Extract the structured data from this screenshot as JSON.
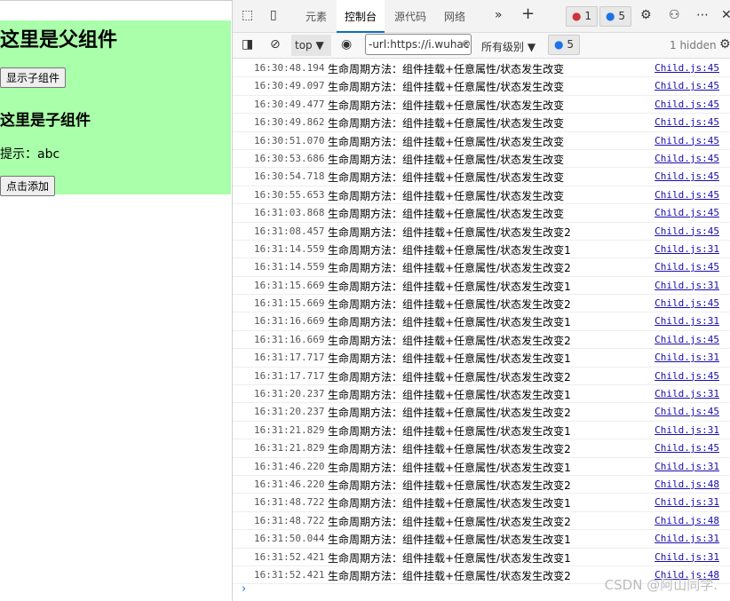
{
  "page": {
    "parent_title": "这里是父组件",
    "show_child_button": "显示子组件",
    "child_title": "这里是子组件",
    "hint": "提示：abc",
    "add_button": "点击添加",
    "parent_bg": "#aaffaa"
  },
  "devtools": {
    "tabs": [
      "元素",
      "控制台",
      "源代码",
      "网络"
    ],
    "active_tab": "控制台",
    "error_count": "1",
    "message_count": "5",
    "context": "top",
    "filter_value": "-url:https://i.wuhac",
    "levels": "所有级别",
    "filter_message_count": "5",
    "hidden": "1 hidden",
    "rows": [
      {
        "ts": "16:30:48.194",
        "msg": "生命周期方法：组件挂载+任意属性/状态发生改变",
        "src": "Child.js:45"
      },
      {
        "ts": "16:30:49.097",
        "msg": "生命周期方法：组件挂载+任意属性/状态发生改变",
        "src": "Child.js:45"
      },
      {
        "ts": "16:30:49.477",
        "msg": "生命周期方法：组件挂载+任意属性/状态发生改变",
        "src": "Child.js:45"
      },
      {
        "ts": "16:30:49.862",
        "msg": "生命周期方法：组件挂载+任意属性/状态发生改变",
        "src": "Child.js:45"
      },
      {
        "ts": "16:30:51.070",
        "msg": "生命周期方法：组件挂载+任意属性/状态发生改变",
        "src": "Child.js:45"
      },
      {
        "ts": "16:30:53.686",
        "msg": "生命周期方法：组件挂载+任意属性/状态发生改变",
        "src": "Child.js:45"
      },
      {
        "ts": "16:30:54.718",
        "msg": "生命周期方法：组件挂载+任意属性/状态发生改变",
        "src": "Child.js:45"
      },
      {
        "ts": "16:30:55.653",
        "msg": "生命周期方法：组件挂载+任意属性/状态发生改变",
        "src": "Child.js:45"
      },
      {
        "ts": "16:31:03.868",
        "msg": "生命周期方法：组件挂载+任意属性/状态发生改变",
        "src": "Child.js:45"
      },
      {
        "ts": "16:31:08.457",
        "msg": "生命周期方法：组件挂载+任意属性/状态发生改变2",
        "src": "Child.js:45"
      },
      {
        "ts": "16:31:14.559",
        "msg": "生命周期方法：组件挂载+任意属性/状态发生改变1",
        "src": "Child.js:31"
      },
      {
        "ts": "16:31:14.559",
        "msg": "生命周期方法：组件挂载+任意属性/状态发生改变2",
        "src": "Child.js:45"
      },
      {
        "ts": "16:31:15.669",
        "msg": "生命周期方法：组件挂载+任意属性/状态发生改变1",
        "src": "Child.js:31"
      },
      {
        "ts": "16:31:15.669",
        "msg": "生命周期方法：组件挂载+任意属性/状态发生改变2",
        "src": "Child.js:45"
      },
      {
        "ts": "16:31:16.669",
        "msg": "生命周期方法：组件挂载+任意属性/状态发生改变1",
        "src": "Child.js:31"
      },
      {
        "ts": "16:31:16.669",
        "msg": "生命周期方法：组件挂载+任意属性/状态发生改变2",
        "src": "Child.js:45"
      },
      {
        "ts": "16:31:17.717",
        "msg": "生命周期方法：组件挂载+任意属性/状态发生改变1",
        "src": "Child.js:31"
      },
      {
        "ts": "16:31:17.717",
        "msg": "生命周期方法：组件挂载+任意属性/状态发生改变2",
        "src": "Child.js:45"
      },
      {
        "ts": "16:31:20.237",
        "msg": "生命周期方法：组件挂载+任意属性/状态发生改变1",
        "src": "Child.js:31"
      },
      {
        "ts": "16:31:20.237",
        "msg": "生命周期方法：组件挂载+任意属性/状态发生改变2",
        "src": "Child.js:45"
      },
      {
        "ts": "16:31:21.829",
        "msg": "生命周期方法：组件挂载+任意属性/状态发生改变1",
        "src": "Child.js:31"
      },
      {
        "ts": "16:31:21.829",
        "msg": "生命周期方法：组件挂载+任意属性/状态发生改变2",
        "src": "Child.js:45"
      },
      {
        "ts": "16:31:46.220",
        "msg": "生命周期方法：组件挂载+任意属性/状态发生改变1",
        "src": "Child.js:31"
      },
      {
        "ts": "16:31:46.220",
        "msg": "生命周期方法：组件挂载+任意属性/状态发生改变2",
        "src": "Child.js:48"
      },
      {
        "ts": "16:31:48.722",
        "msg": "生命周期方法：组件挂载+任意属性/状态发生改变1",
        "src": "Child.js:31"
      },
      {
        "ts": "16:31:48.722",
        "msg": "生命周期方法：组件挂载+任意属性/状态发生改变2",
        "src": "Child.js:48"
      },
      {
        "ts": "16:31:50.044",
        "msg": "生命周期方法：组件挂载+任意属性/状态发生改变1",
        "src": "Child.js:31"
      },
      {
        "ts": "16:31:52.421",
        "msg": "生命周期方法：组件挂载+任意属性/状态发生改变1",
        "src": "Child.js:31"
      },
      {
        "ts": "16:31:52.421",
        "msg": "生命周期方法：组件挂载+任意属性/状态发生改变2",
        "src": "Child.js:48"
      }
    ]
  },
  "watermark": "CSDN @阿山同学."
}
